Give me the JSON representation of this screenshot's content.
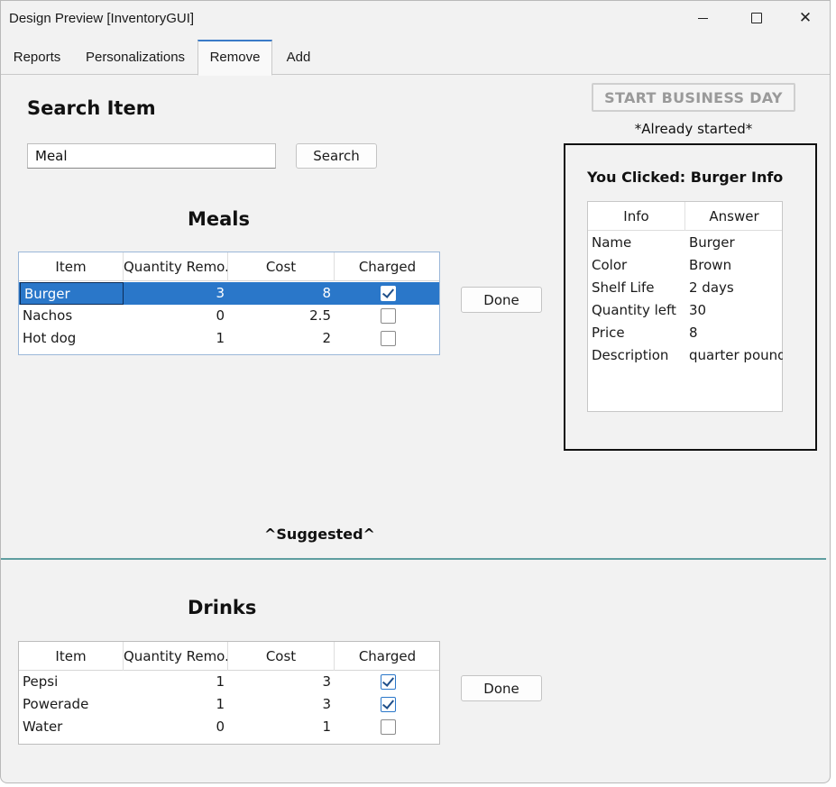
{
  "window": {
    "title": "Design Preview [InventoryGUI]",
    "close_glyph": "✕"
  },
  "tabs": [
    {
      "label": "Reports"
    },
    {
      "label": "Personalizations"
    },
    {
      "label": "Remove",
      "active": true
    },
    {
      "label": "Add"
    }
  ],
  "search": {
    "heading": "Search Item",
    "value": "Meal",
    "button_label": "Search"
  },
  "business": {
    "button_label": "START BUSINESS DAY",
    "status_note": "*Already started*"
  },
  "meals": {
    "heading": "Meals",
    "columns": [
      "Item",
      "Quantity Remo...",
      "Cost",
      "Charged"
    ],
    "rows": [
      {
        "item": "Burger",
        "qty": "3",
        "cost": "8",
        "charged": true,
        "selected": true
      },
      {
        "item": "Nachos",
        "qty": "0",
        "cost": "2.5",
        "charged": false
      },
      {
        "item": "Hot dog",
        "qty": "1",
        "cost": "2",
        "charged": false
      }
    ],
    "done_label": "Done"
  },
  "suggested_label": "^Suggested^",
  "drinks": {
    "heading": "Drinks",
    "columns": [
      "Item",
      "Quantity Remo...",
      "Cost",
      "Charged"
    ],
    "rows": [
      {
        "item": "Pepsi",
        "qty": "1",
        "cost": "3",
        "charged": true
      },
      {
        "item": "Powerade",
        "qty": "1",
        "cost": "3",
        "charged": true
      },
      {
        "item": "Water",
        "qty": "0",
        "cost": "1",
        "charged": false
      }
    ],
    "done_label": "Done"
  },
  "info_panel": {
    "heading": "You Clicked: Burger Info",
    "columns": [
      "Info",
      "Answer"
    ],
    "rows": [
      {
        "info": "Name",
        "answer": "Burger"
      },
      {
        "info": "Color",
        "answer": "Brown"
      },
      {
        "info": "Shelf Life",
        "answer": "2 days"
      },
      {
        "info": "Quantity left",
        "answer": "30"
      },
      {
        "info": "Price",
        "answer": "8"
      },
      {
        "info": "Description",
        "answer": "quarter pound..."
      }
    ]
  },
  "colors": {
    "selection": "#2a77c9",
    "divider": "#5f9ea0",
    "active_tab_accent": "#3a7bc8"
  }
}
